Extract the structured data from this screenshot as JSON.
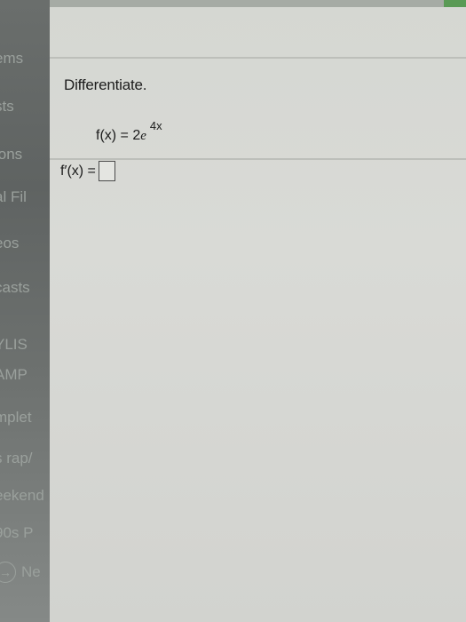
{
  "sidebar": {
    "items": [
      {
        "label": "ems"
      },
      {
        "label": "sts"
      },
      {
        "label": "ions"
      },
      {
        "label": "al Fil"
      },
      {
        "label": "eos"
      },
      {
        "label": "casts"
      },
      {
        "label": "YLIS"
      },
      {
        "label": "AMP"
      },
      {
        "label": "mplet"
      },
      {
        "label": "s rap/"
      },
      {
        "label": "eekend"
      },
      {
        "label": "90s P"
      },
      {
        "label": "Ne"
      }
    ],
    "next_icon": "→"
  },
  "problem": {
    "heading": "Differentiate.",
    "function_lhs": "f(x) = 2",
    "function_base": "e",
    "function_exponent": "4x",
    "answer_label": "f′(x) ="
  }
}
